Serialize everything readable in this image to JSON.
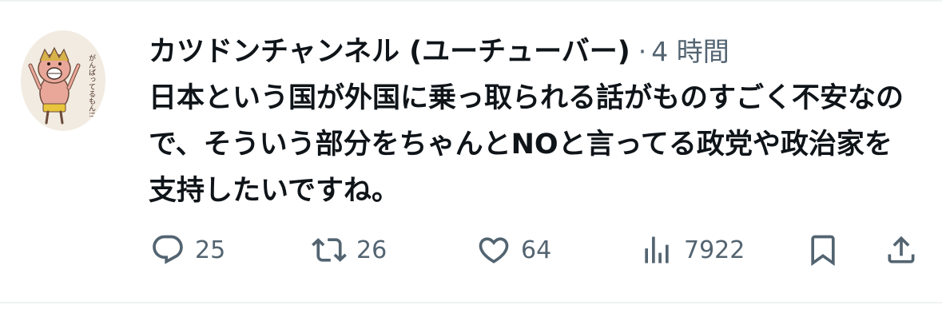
{
  "tweet": {
    "display_name": "カツドンチャンネル (ユーチューバー)",
    "separator": "·",
    "timestamp": "4 時間",
    "text": "日本という国が外国に乗っ取られる話がものすごく不安なので、そういう部分をちゃんとNOと言ってる政党や政治家を支持したいですね。",
    "avatar_text": "がんばってるもん!!"
  },
  "actions": {
    "reply": {
      "icon": "reply-icon",
      "count": "25"
    },
    "retweet": {
      "icon": "retweet-icon",
      "count": "26"
    },
    "like": {
      "icon": "heart-icon",
      "count": "64"
    },
    "views": {
      "icon": "views-chart-icon",
      "count": "7922"
    },
    "bookmark": {
      "icon": "bookmark-icon"
    },
    "share": {
      "icon": "share-icon"
    }
  },
  "colors": {
    "text": "#0f1419",
    "secondary": "#536471",
    "divider": "#eff3f4"
  }
}
